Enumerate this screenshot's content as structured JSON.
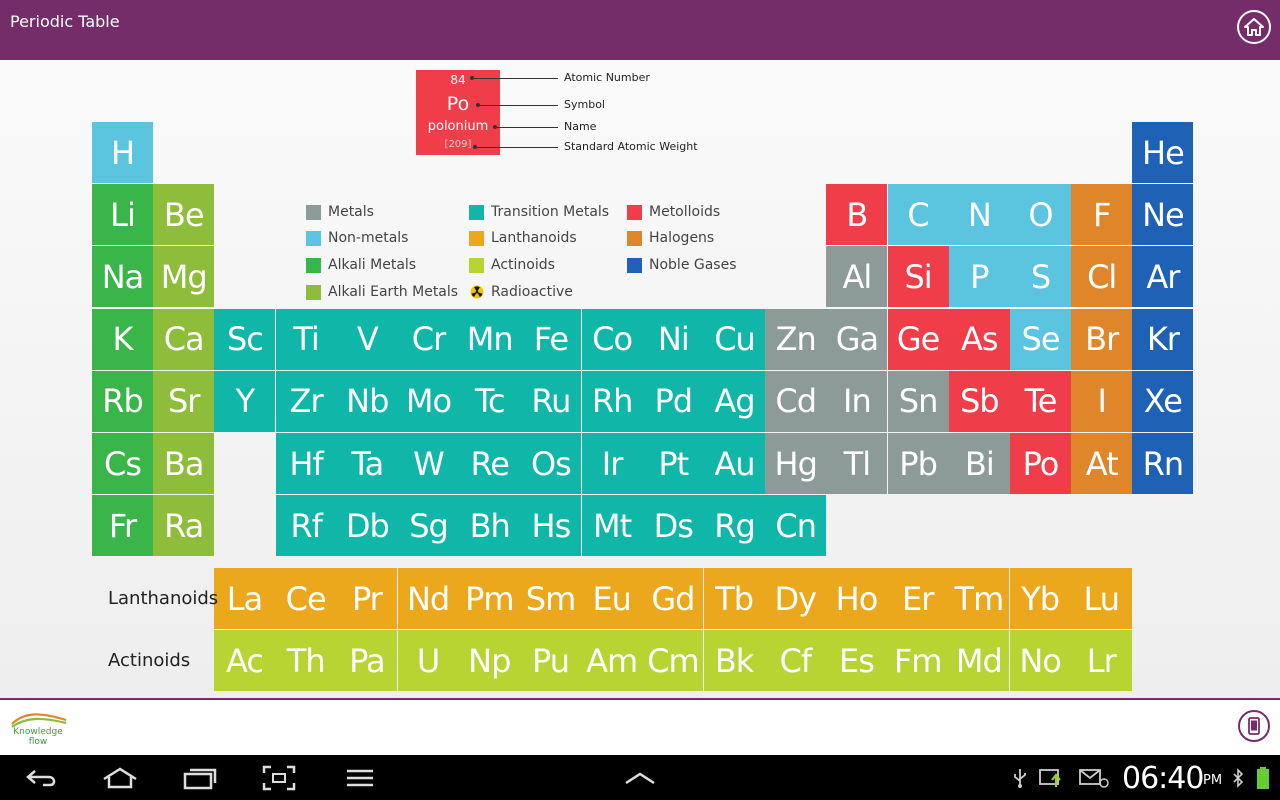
{
  "app": {
    "title": "Periodic Table"
  },
  "colors": {
    "metals": "#8c9b98",
    "nonmetals": "#5bc4de",
    "alkali": "#3ab54a",
    "alkaline_earth": "#8dbd3a",
    "transition": "#10b7a8",
    "lanthanoids": "#eba81d",
    "actinoids": "#b8d433",
    "metalloids": "#ef3e4a",
    "halogens": "#e0862a",
    "noble": "#1f61b4",
    "header": "#742d68"
  },
  "key": {
    "number": "84",
    "symbol": "Po",
    "name": "polonium",
    "weight": "[209]",
    "labels": {
      "number": "Atomic Number",
      "symbol": "Symbol",
      "name": "Name",
      "weight": "Standard Atomic Weight"
    }
  },
  "legend": [
    {
      "label": "Metals",
      "color": "#8c9b98"
    },
    {
      "label": "Non-metals",
      "color": "#5bc4de"
    },
    {
      "label": "Alkali Metals",
      "color": "#3ab54a"
    },
    {
      "label": "Alkali Earth Metals",
      "color": "#8dbd3a"
    },
    {
      "label": "Transition Metals",
      "color": "#10b7a8"
    },
    {
      "label": "Lanthanoids",
      "color": "#eba81d"
    },
    {
      "label": "Actinoids",
      "color": "#b8d433"
    },
    {
      "label": "Radioactive",
      "icon": "radioactive-icon"
    },
    {
      "label": "Metolloids",
      "color": "#ef3e4a"
    },
    {
      "label": "Halogens",
      "color": "#e0862a"
    },
    {
      "label": "Noble Gases",
      "color": "#1f61b4"
    }
  ],
  "row_labels": {
    "lanthanoids": "Lanthanoids",
    "actinoids": "Actinoids"
  },
  "elements": [
    {
      "symbol": "H",
      "category": "nonmetals",
      "period": 1,
      "group": 1
    },
    {
      "symbol": "He",
      "category": "noble",
      "period": 1,
      "group": 18
    },
    {
      "symbol": "Li",
      "category": "alkali",
      "period": 2,
      "group": 1
    },
    {
      "symbol": "Be",
      "category": "alkaline_earth",
      "period": 2,
      "group": 2
    },
    {
      "symbol": "B",
      "category": "metalloids",
      "period": 2,
      "group": 13
    },
    {
      "symbol": "C",
      "category": "nonmetals",
      "period": 2,
      "group": 14
    },
    {
      "symbol": "N",
      "category": "nonmetals",
      "period": 2,
      "group": 15
    },
    {
      "symbol": "O",
      "category": "nonmetals",
      "period": 2,
      "group": 16
    },
    {
      "symbol": "F",
      "category": "halogens",
      "period": 2,
      "group": 17
    },
    {
      "symbol": "Ne",
      "category": "noble",
      "period": 2,
      "group": 18
    },
    {
      "symbol": "Na",
      "category": "alkali",
      "period": 3,
      "group": 1
    },
    {
      "symbol": "Mg",
      "category": "alkaline_earth",
      "period": 3,
      "group": 2
    },
    {
      "symbol": "Al",
      "category": "metals",
      "period": 3,
      "group": 13
    },
    {
      "symbol": "Si",
      "category": "metalloids",
      "period": 3,
      "group": 14
    },
    {
      "symbol": "P",
      "category": "nonmetals",
      "period": 3,
      "group": 15
    },
    {
      "symbol": "S",
      "category": "nonmetals",
      "period": 3,
      "group": 16
    },
    {
      "symbol": "Cl",
      "category": "halogens",
      "period": 3,
      "group": 17
    },
    {
      "symbol": "Ar",
      "category": "noble",
      "period": 3,
      "group": 18
    },
    {
      "symbol": "K",
      "category": "alkali",
      "period": 4,
      "group": 1
    },
    {
      "symbol": "Ca",
      "category": "alkaline_earth",
      "period": 4,
      "group": 2
    },
    {
      "symbol": "Sc",
      "category": "transition",
      "period": 4,
      "group": 3
    },
    {
      "symbol": "Ti",
      "category": "transition",
      "period": 4,
      "group": 4
    },
    {
      "symbol": "V",
      "category": "transition",
      "period": 4,
      "group": 5
    },
    {
      "symbol": "Cr",
      "category": "transition",
      "period": 4,
      "group": 6
    },
    {
      "symbol": "Mn",
      "category": "transition",
      "period": 4,
      "group": 7
    },
    {
      "symbol": "Fe",
      "category": "transition",
      "period": 4,
      "group": 8
    },
    {
      "symbol": "Co",
      "category": "transition",
      "period": 4,
      "group": 9
    },
    {
      "symbol": "Ni",
      "category": "transition",
      "period": 4,
      "group": 10
    },
    {
      "symbol": "Cu",
      "category": "transition",
      "period": 4,
      "group": 11
    },
    {
      "symbol": "Zn",
      "category": "metals",
      "period": 4,
      "group": 12
    },
    {
      "symbol": "Ga",
      "category": "metals",
      "period": 4,
      "group": 13
    },
    {
      "symbol": "Ge",
      "category": "metalloids",
      "period": 4,
      "group": 14
    },
    {
      "symbol": "As",
      "category": "metalloids",
      "period": 4,
      "group": 15
    },
    {
      "symbol": "Se",
      "category": "nonmetals",
      "period": 4,
      "group": 16
    },
    {
      "symbol": "Br",
      "category": "halogens",
      "period": 4,
      "group": 17
    },
    {
      "symbol": "Kr",
      "category": "noble",
      "period": 4,
      "group": 18
    },
    {
      "symbol": "Rb",
      "category": "alkali",
      "period": 5,
      "group": 1
    },
    {
      "symbol": "Sr",
      "category": "alkaline_earth",
      "period": 5,
      "group": 2
    },
    {
      "symbol": "Y",
      "category": "transition",
      "period": 5,
      "group": 3
    },
    {
      "symbol": "Zr",
      "category": "transition",
      "period": 5,
      "group": 4
    },
    {
      "symbol": "Nb",
      "category": "transition",
      "period": 5,
      "group": 5
    },
    {
      "symbol": "Mo",
      "category": "transition",
      "period": 5,
      "group": 6
    },
    {
      "symbol": "Tc",
      "category": "transition",
      "period": 5,
      "group": 7
    },
    {
      "symbol": "Ru",
      "category": "transition",
      "period": 5,
      "group": 8
    },
    {
      "symbol": "Rh",
      "category": "transition",
      "period": 5,
      "group": 9
    },
    {
      "symbol": "Pd",
      "category": "transition",
      "period": 5,
      "group": 10
    },
    {
      "symbol": "Ag",
      "category": "transition",
      "period": 5,
      "group": 11
    },
    {
      "symbol": "Cd",
      "category": "metals",
      "period": 5,
      "group": 12
    },
    {
      "symbol": "In",
      "category": "metals",
      "period": 5,
      "group": 13
    },
    {
      "symbol": "Sn",
      "category": "metals",
      "period": 5,
      "group": 14
    },
    {
      "symbol": "Sb",
      "category": "metalloids",
      "period": 5,
      "group": 15
    },
    {
      "symbol": "Te",
      "category": "metalloids",
      "period": 5,
      "group": 16
    },
    {
      "symbol": "I",
      "category": "halogens",
      "period": 5,
      "group": 17
    },
    {
      "symbol": "Xe",
      "category": "noble",
      "period": 5,
      "group": 18
    },
    {
      "symbol": "Cs",
      "category": "alkali",
      "period": 6,
      "group": 1
    },
    {
      "symbol": "Ba",
      "category": "alkaline_earth",
      "period": 6,
      "group": 2
    },
    {
      "symbol": "Hf",
      "category": "transition",
      "period": 6,
      "group": 4
    },
    {
      "symbol": "Ta",
      "category": "transition",
      "period": 6,
      "group": 5
    },
    {
      "symbol": "W",
      "category": "transition",
      "period": 6,
      "group": 6
    },
    {
      "symbol": "Re",
      "category": "transition",
      "period": 6,
      "group": 7
    },
    {
      "symbol": "Os",
      "category": "transition",
      "period": 6,
      "group": 8
    },
    {
      "symbol": "Ir",
      "category": "transition",
      "period": 6,
      "group": 9
    },
    {
      "symbol": "Pt",
      "category": "transition",
      "period": 6,
      "group": 10
    },
    {
      "symbol": "Au",
      "category": "transition",
      "period": 6,
      "group": 11
    },
    {
      "symbol": "Hg",
      "category": "metals",
      "period": 6,
      "group": 12
    },
    {
      "symbol": "Tl",
      "category": "metals",
      "period": 6,
      "group": 13
    },
    {
      "symbol": "Pb",
      "category": "metals",
      "period": 6,
      "group": 14
    },
    {
      "symbol": "Bi",
      "category": "metals",
      "period": 6,
      "group": 15
    },
    {
      "symbol": "Po",
      "category": "metalloids",
      "period": 6,
      "group": 16
    },
    {
      "symbol": "At",
      "category": "halogens",
      "period": 6,
      "group": 17
    },
    {
      "symbol": "Rn",
      "category": "noble",
      "period": 6,
      "group": 18
    },
    {
      "symbol": "Fr",
      "category": "alkali",
      "period": 7,
      "group": 1
    },
    {
      "symbol": "Ra",
      "category": "alkaline_earth",
      "period": 7,
      "group": 2
    },
    {
      "symbol": "Rf",
      "category": "transition",
      "period": 7,
      "group": 4
    },
    {
      "symbol": "Db",
      "category": "transition",
      "period": 7,
      "group": 5
    },
    {
      "symbol": "Sg",
      "category": "transition",
      "period": 7,
      "group": 6
    },
    {
      "symbol": "Bh",
      "category": "transition",
      "period": 7,
      "group": 7
    },
    {
      "symbol": "Hs",
      "category": "transition",
      "period": 7,
      "group": 8
    },
    {
      "symbol": "Mt",
      "category": "transition",
      "period": 7,
      "group": 9
    },
    {
      "symbol": "Ds",
      "category": "transition",
      "period": 7,
      "group": 10
    },
    {
      "symbol": "Rg",
      "category": "transition",
      "period": 7,
      "group": 11
    },
    {
      "symbol": "Cn",
      "category": "transition",
      "period": 7,
      "group": 12
    }
  ],
  "lanthanoids": [
    "La",
    "Ce",
    "Pr",
    "Nd",
    "Pm",
    "Sm",
    "Eu",
    "Gd",
    "Tb",
    "Dy",
    "Ho",
    "Er",
    "Tm",
    "Yb",
    "Lu"
  ],
  "actinoids": [
    "Ac",
    "Th",
    "Pa",
    "U",
    "Np",
    "Pu",
    "Am",
    "Cm",
    "Bk",
    "Cf",
    "Es",
    "Fm",
    "Md",
    "No",
    "Lr"
  ],
  "footer": {
    "logo_text": "Knowledge flow"
  },
  "status": {
    "time": "06:40",
    "ampm": "PM"
  }
}
